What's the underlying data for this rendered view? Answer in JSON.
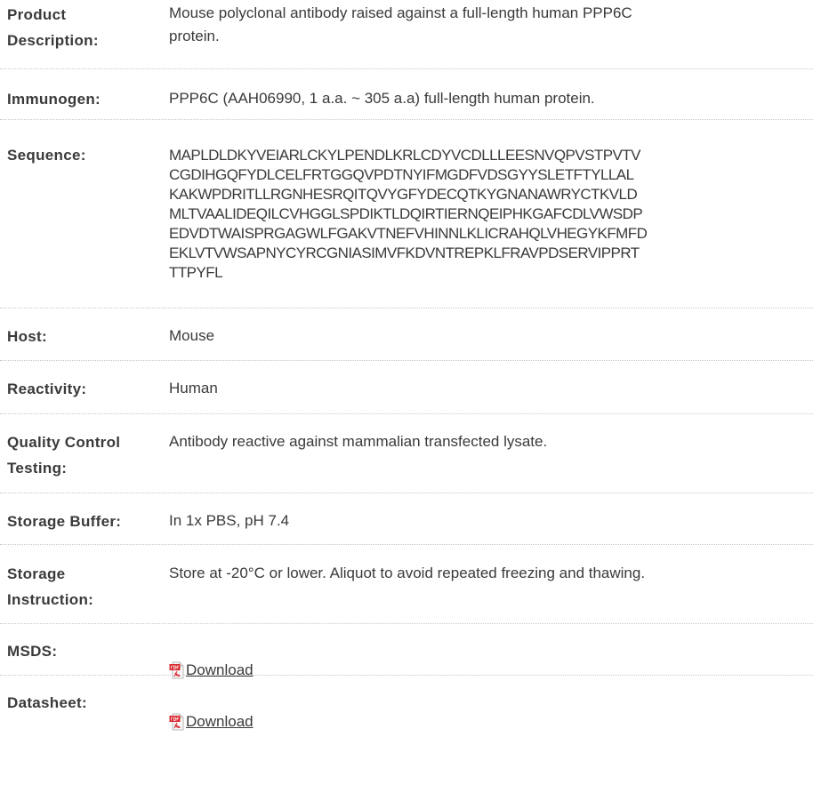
{
  "rows": [
    {
      "label": "Product\nDescription:",
      "value": "Mouse polyclonal antibody raised against a full-length human PPP6C\nprotein."
    },
    {
      "label": "Immunogen:",
      "value": "PPP6C (AAH06990, 1 a.a. ~ 305 a.a) full-length human protein."
    },
    {
      "label": "Sequence:",
      "value": "MAPLDLDKYVEIARLCKYLPENDLKRLCDYVCDLLLEESNVQPVSTPVTV\nCGDIHGQFYDLCELFRTGGQVPDTNYIFMGDFVDSGYYSLETFTYLLAL\nKAKWPDRITLLRGNHESRQITQVYGFYDECQTKYGNANAWRYCTKVLD\nMLTVAALIDEQILCVHGGLSPDIKTLDQIRTIERNQEIPHKGAFCDLVWSDP\nEDVDTWAISPRGAGWLFGAKVTNEFVHINNLKLICRAHQLVHEGYKFMFD\nEKLVTVWSAPNYCYRCGNIASIMVFKDVNTREPKLFRAVPDSERVIPPRT\nTTPYFL"
    },
    {
      "label": "Host:",
      "value": "Mouse"
    },
    {
      "label": "Reactivity:",
      "value": "Human"
    },
    {
      "label": "Quality Control\nTesting:",
      "value": "Antibody reactive against mammalian transfected lysate."
    },
    {
      "label": "Storage Buffer:",
      "value": "In 1x PBS, pH 7.4"
    },
    {
      "label": "Storage\nInstruction:",
      "value": "Store at -20°C or lower. Aliquot to avoid repeated freezing and thawing."
    },
    {
      "label": "MSDS:",
      "link": "Download",
      "icon": "pdf-icon"
    },
    {
      "label": "Datasheet:",
      "link": "Download",
      "icon": "pdf-icon"
    }
  ]
}
